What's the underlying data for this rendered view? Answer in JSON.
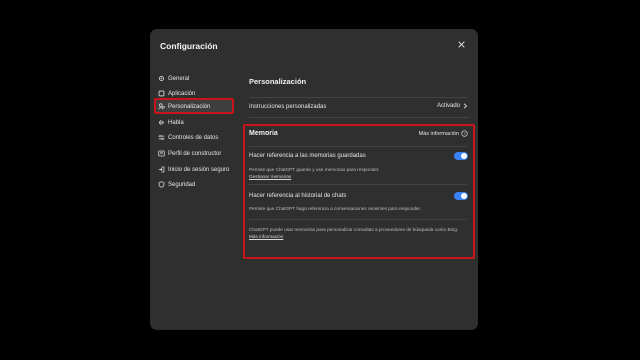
{
  "dialog": {
    "title": "Configuración",
    "close_icon": "close-icon"
  },
  "sidebar": {
    "items": [
      {
        "label": "General",
        "icon": "gear-icon"
      },
      {
        "label": "Aplicación",
        "icon": "app-icon"
      },
      {
        "label": "Personalización",
        "icon": "personalization-icon"
      },
      {
        "label": "Habla",
        "icon": "mic-icon"
      },
      {
        "label": "Controles de datos",
        "icon": "data-icon"
      },
      {
        "label": "Perfil de constructor",
        "icon": "profile-icon"
      },
      {
        "label": "Inicio de sesión seguro",
        "icon": "login-icon"
      },
      {
        "label": "Seguridad",
        "icon": "shield-icon"
      }
    ],
    "active_index": 2
  },
  "main": {
    "section_title": "Personalización",
    "custom_instructions": {
      "label": "Instrucciones personalizadas",
      "value": "Activado"
    },
    "memory": {
      "title": "Memoria",
      "more_info": "Más información",
      "saved_memories": {
        "label": "Hacer referencia a las memorias guardadas",
        "description": "Permite que ChatGPT guarde y use memorias para responder.",
        "link": "Gestionar memorias",
        "enabled": true
      },
      "chat_history": {
        "label": "Hacer referencia al historial de chats",
        "description": "Permite que ChatGPT haga referencia a conversaciones recientes para responder.",
        "enabled": true
      },
      "footnote": "ChatGPT puede usar memorias para personalizar consultas a proveedores de búsqueda como Bing.",
      "footnote_link": "Más información"
    }
  },
  "colors": {
    "accent": "#3b82f6",
    "highlight": "#c8141a",
    "dialog_bg": "#2f2f2f"
  }
}
